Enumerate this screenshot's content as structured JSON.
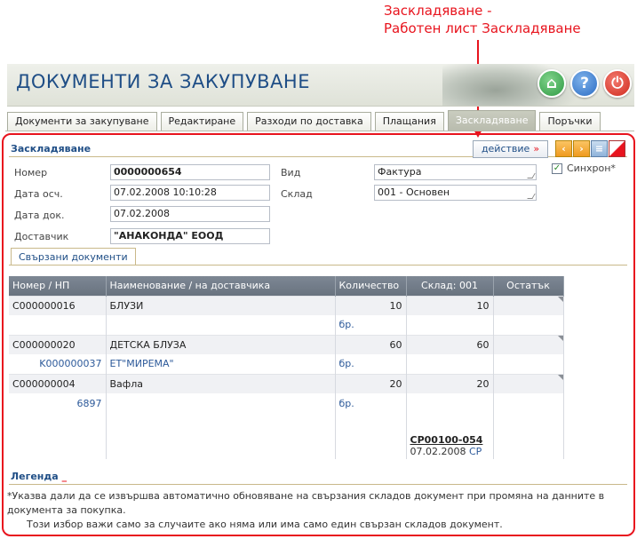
{
  "annotation": {
    "line1": "Заскладяване -",
    "line2": "Работен лист Заскладяване"
  },
  "header": {
    "title": "ДОКУМЕНТИ ЗА ЗАКУПУВАНЕ",
    "home_icon": "⌂",
    "help_icon": "?",
    "power_icon": "⏻"
  },
  "tabs": [
    {
      "label": "Документи за закупуване"
    },
    {
      "label": "Редактиране"
    },
    {
      "label": "Разходи по доставка"
    },
    {
      "label": "Плащания"
    },
    {
      "label": "Заскладяване"
    },
    {
      "label": "Поръчки"
    }
  ],
  "section": {
    "title": "Заскладяване",
    "action_label": "действие",
    "action_arrow": "»"
  },
  "form": {
    "number_label": "Номер",
    "number_value": "0000000654",
    "date_label": "Дата осч.",
    "date_value": "07.02.2008 10:10:28",
    "docdate_label": "Дата док.",
    "docdate_value": "07.02.2008",
    "supplier_label": "Доставчик",
    "supplier_value": "\"АНАКОНДА\" ЕООД",
    "type_label": "Вид",
    "type_value": "Фактура",
    "warehouse_label": "Склад",
    "warehouse_value": "001 - Основен",
    "sync_label": "Синхрон*",
    "sync_checked": "✓"
  },
  "subtab": {
    "label": "Свързани документи"
  },
  "table": {
    "headers": [
      "Номер / НП",
      "Наименование / на доставчика",
      "Количество",
      "Склад: 001",
      "Остатък"
    ],
    "rows": [
      {
        "code": "C000000016",
        "name": "БЛУЗИ",
        "qty": "10",
        "wh": "10",
        "sub_code": "",
        "sub_name": "",
        "unit": "бр."
      },
      {
        "code": "C000000020",
        "name": "ДЕТСКА БЛУЗА",
        "qty": "60",
        "wh": "60",
        "sub_code": "K000000037",
        "sub_name": "ЕТ\"МИРЕМА\"",
        "unit": "бр."
      },
      {
        "code": "C000000004",
        "name": "Вафла",
        "qty": "20",
        "wh": "20",
        "sub_code": "6897",
        "sub_name": "",
        "unit": "бр."
      }
    ],
    "footer": {
      "doc": "CP00100-054",
      "date": "07.02.2008",
      "type": "CP"
    }
  },
  "legend": {
    "title": "Легенда",
    "marker": "_",
    "text1": "*Указва дали да се извършва автоматично обновяване на свързания складов документ при промяна на данните в документа за покупка.",
    "text2": "Този избор важи само за случаите ако няма или има само един свързан складов документ."
  },
  "colors": {
    "accent": "#e8141e",
    "title_blue": "#1f4e86",
    "grid_header": "#727c88"
  }
}
